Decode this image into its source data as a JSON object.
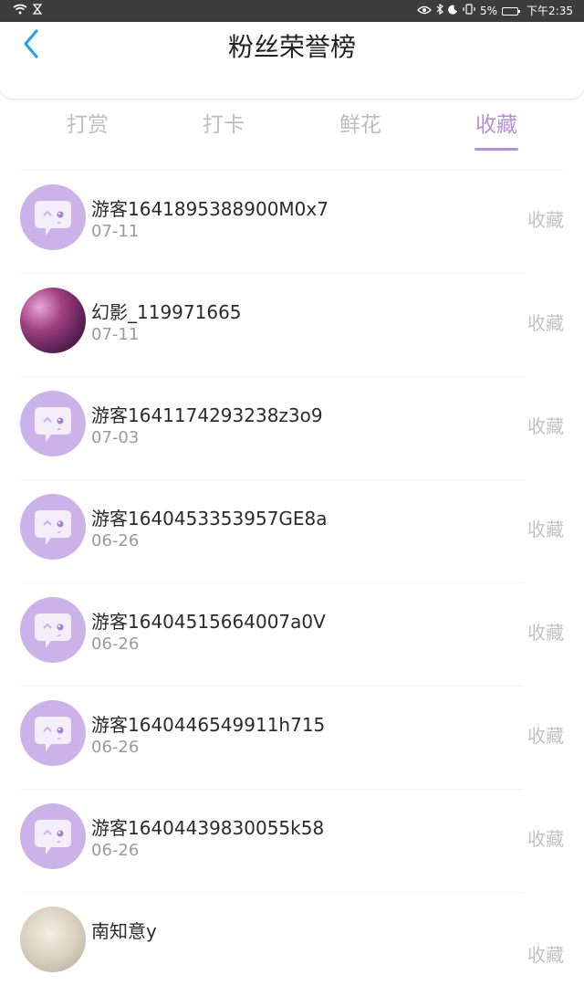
{
  "status_bar": {
    "right_text_battery": "5%",
    "time": "下午2:35"
  },
  "header": {
    "title": "粉丝荣誉榜"
  },
  "tabs": [
    {
      "label": "打赏",
      "active": false
    },
    {
      "label": "打卡",
      "active": false
    },
    {
      "label": "鲜花",
      "active": false
    },
    {
      "label": "收藏",
      "active": true
    }
  ],
  "accent_color": "#b690d6",
  "list": [
    {
      "name": "游客1641895388900M0x7",
      "date": "07-11",
      "action": "收藏",
      "avatar": "default-chat-avatar"
    },
    {
      "name": "幻影_119971665",
      "date": "07-11",
      "action": "收藏",
      "avatar": "photo-avatar"
    },
    {
      "name": "游客1641174293238z3o9",
      "date": "07-03",
      "action": "收藏",
      "avatar": "default-chat-avatar"
    },
    {
      "name": "游客1640453353957GE8a",
      "date": "06-26",
      "action": "收藏",
      "avatar": "default-chat-avatar"
    },
    {
      "name": "游客16404515664007a0V",
      "date": "06-26",
      "action": "收藏",
      "avatar": "default-chat-avatar"
    },
    {
      "name": "游客1640446549911h715",
      "date": "06-26",
      "action": "收藏",
      "avatar": "default-chat-avatar"
    },
    {
      "name": "游客16404439830055k58",
      "date": "06-26",
      "action": "收藏",
      "avatar": "default-chat-avatar"
    },
    {
      "name": "南知意y",
      "date": "",
      "action": "收藏",
      "avatar": "photo-avatar"
    }
  ]
}
